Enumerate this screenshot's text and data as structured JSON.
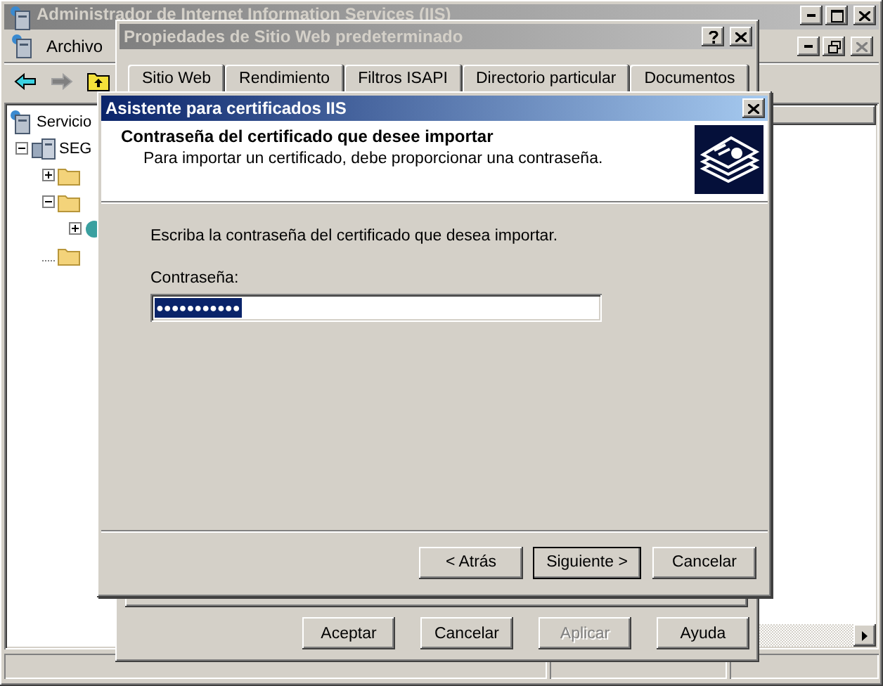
{
  "main_window": {
    "title": "Administrador de Internet Information Services (IIS)",
    "active": false,
    "menu": [
      {
        "label": "Archivo"
      }
    ],
    "toolbar": [
      {
        "kind": "back",
        "disabled": false
      },
      {
        "kind": "forward",
        "disabled": true
      },
      {
        "kind": "up",
        "disabled": false
      }
    ],
    "tree": [
      {
        "label": "Servicio",
        "kind": "services",
        "children": [
          {
            "label": "SEG",
            "kind": "server",
            "expanded": true,
            "children": [
              {
                "kind": "folder",
                "expanded": false
              },
              {
                "kind": "folder",
                "expanded": true,
                "children": [
                  {
                    "kind": "site",
                    "expanded": false
                  }
                ]
              },
              {
                "kind": "folder"
              }
            ]
          }
        ]
      }
    ]
  },
  "properties_dialog": {
    "title": "Propiedades de Sitio Web predeterminado",
    "active": false,
    "tabs": [
      {
        "label": "Sitio Web",
        "selected": false
      },
      {
        "label": "Rendimiento",
        "selected": false
      },
      {
        "label": "Filtros ISAPI",
        "selected": false
      },
      {
        "label": "Directorio particular",
        "selected": false
      },
      {
        "label": "Documentos",
        "selected": false
      }
    ],
    "buttons": [
      {
        "label": "Aceptar",
        "disabled": false
      },
      {
        "label": "Cancelar",
        "disabled": false
      },
      {
        "label": "Aplicar",
        "disabled": true
      },
      {
        "label": "Ayuda",
        "disabled": false
      }
    ]
  },
  "wizard": {
    "title": "Asistente para certificados IIS",
    "active": true,
    "heading": "Contraseña del certificado que desee importar",
    "subheading": "Para importar un certificado, debe proporcionar una contraseña.",
    "instruction": "Escriba la contraseña del certificado que desea importar.",
    "password": {
      "label": "Contraseña:",
      "value": "●●●●●●●●●●●",
      "text_selected": true
    },
    "buttons": [
      {
        "label": "< Atrás",
        "default": false
      },
      {
        "label": "Siguiente >",
        "default": true
      },
      {
        "label": "Cancelar",
        "default": false
      }
    ]
  }
}
